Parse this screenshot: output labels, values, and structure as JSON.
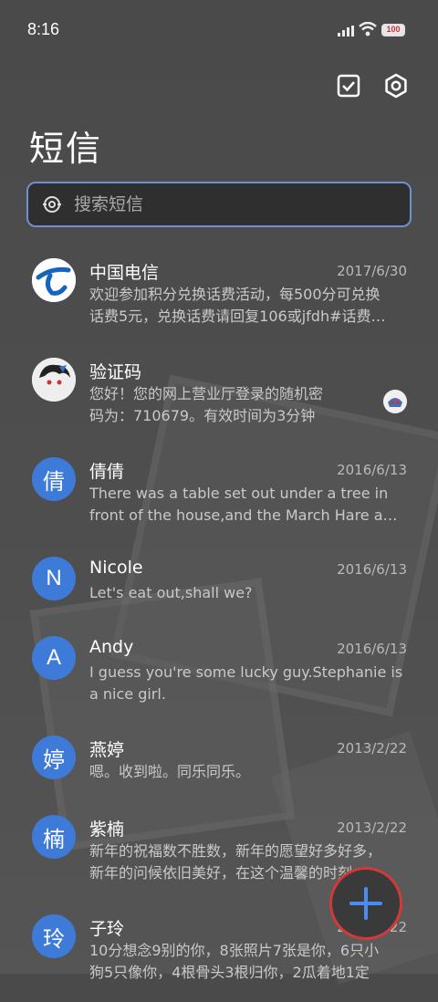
{
  "status": {
    "time": "8:16",
    "battery": "100"
  },
  "header": {
    "title": "短信"
  },
  "search": {
    "placeholder": "搜索短信"
  },
  "messages": [
    {
      "name": "中国电信",
      "date": "2017/6/30",
      "line1": "欢迎参加积分兑换话费活动，每500分可兑换",
      "line2": "话费5元，兑换话费请回复106或jfdh#话费…",
      "avatar": ""
    },
    {
      "name": "验证码",
      "date": "",
      "line1": "您好！您的网上营业厅登录的随机密",
      "line2": "码为：710679。有效时间为3分钟",
      "avatar": ""
    },
    {
      "name": "倩倩",
      "date": "2016/6/13",
      "line1": "There was a table set out under a tree in",
      "line2": "front of the house,and the March Hare an…",
      "avatar": "倩"
    },
    {
      "name": "Nicole",
      "date": "2016/6/13",
      "line1": "Let's eat out,shall we?",
      "line2": "",
      "avatar": "N"
    },
    {
      "name": "Andy",
      "date": "2016/6/13",
      "line1": "I guess you're some lucky guy.Stephanie is",
      "line2": "a nice girl.",
      "avatar": "A"
    },
    {
      "name": "燕婷",
      "date": "2013/2/22",
      "line1": "嗯。收到啦。同乐同乐。",
      "line2": "",
      "avatar": "婷"
    },
    {
      "name": "紫楠",
      "date": "2013/2/22",
      "line1": "新年的祝福数不胜数，新年的愿望好多好多，",
      "line2": "新年的问候依旧美好，在这个温馨的时刻…",
      "avatar": "楠"
    },
    {
      "name": "子玲",
      "date": "2013/2/22",
      "line1": "10分想念9别的你，8张照片7张是你，6只小",
      "line2": "狗5只像你，4根骨头3根归你，2瓜着地1定",
      "avatar": "玲"
    }
  ],
  "colors": {
    "accent": "#3e7bd9",
    "fab_ring": "#d23a3a"
  }
}
